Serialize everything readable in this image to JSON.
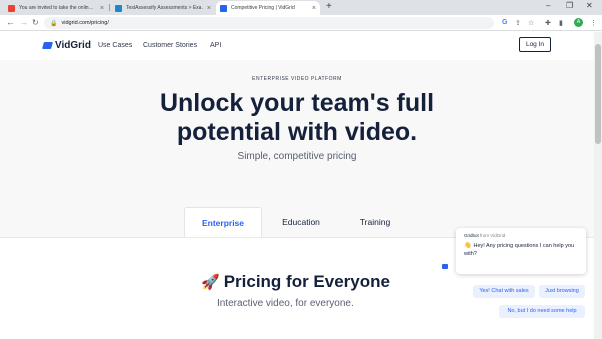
{
  "browser": {
    "tabs": [
      {
        "title": "You are invited to take the onlin…",
        "icon": "gmail-icon",
        "active": false
      },
      {
        "title": "TestAssessify Assessments > Exa…",
        "icon": "testassessify-icon",
        "active": false
      },
      {
        "title": "Competitive Pricing | VidGrid",
        "icon": "vidgrid-icon",
        "active": true
      }
    ],
    "new_tab_label": "+",
    "url": "vidgrid.com/pricing/",
    "profile_initial": "A"
  },
  "site": {
    "brand": "VidGrid",
    "nav": [
      "Use Cases",
      "Customer Stories",
      "API"
    ],
    "login_label": "Log In"
  },
  "hero": {
    "eyebrow": "ENTERPRISE VIDEO PLATFORM",
    "headline_line1": "Unlock your team's full",
    "headline_line2": "potential with video.",
    "subhead": "Simple, competitive pricing"
  },
  "pricing_tabs": [
    {
      "label": "Enterprise",
      "active": true
    },
    {
      "label": "Education",
      "active": false
    },
    {
      "label": "Training",
      "active": false
    }
  ],
  "pricing": {
    "title": "Pricing for Everyone",
    "subtitle": "Interactive video, for everyone."
  },
  "chat": {
    "bot_name": "Gridbot",
    "from_text": "from VidGrid",
    "message": "Hey! Any pricing questions I can help you with?",
    "replies": [
      "Yes! Chat with sales",
      "Just browsing",
      "No, but I do need some help"
    ]
  },
  "colors": {
    "accent": "#2a62f0",
    "heading": "#15213a",
    "hero_bg": "#f8f8f9"
  }
}
